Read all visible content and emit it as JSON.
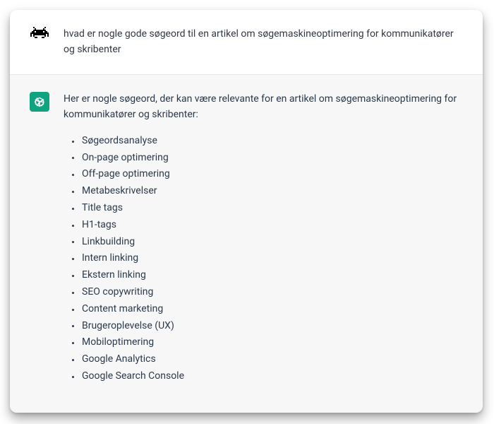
{
  "user": {
    "message": "hvad er nogle gode søgeord til en artikel om søgemaskineoptimering for kommunikatører og skribenter"
  },
  "assistant": {
    "intro": "Her er nogle søgeord, der kan være relevante for en artikel om søgemaskineoptimering for kommunikatører og skribenter:",
    "keywords": [
      "Søgeordsanalyse",
      "On-page optimering",
      "Off-page optimering",
      "Metabeskrivelser",
      "Title tags",
      "H1-tags",
      "Linkbuilding",
      "Intern linking",
      "Ekstern linking",
      "SEO copywriting",
      "Content marketing",
      "Brugeroplevelse (UX)",
      "Mobiloptimering",
      "Google Analytics",
      "Google Search Console"
    ]
  },
  "colors": {
    "assistant_bg": "#f7f7f8",
    "assistant_avatar_bg": "#10a37f",
    "text": "#2b3a4a"
  }
}
